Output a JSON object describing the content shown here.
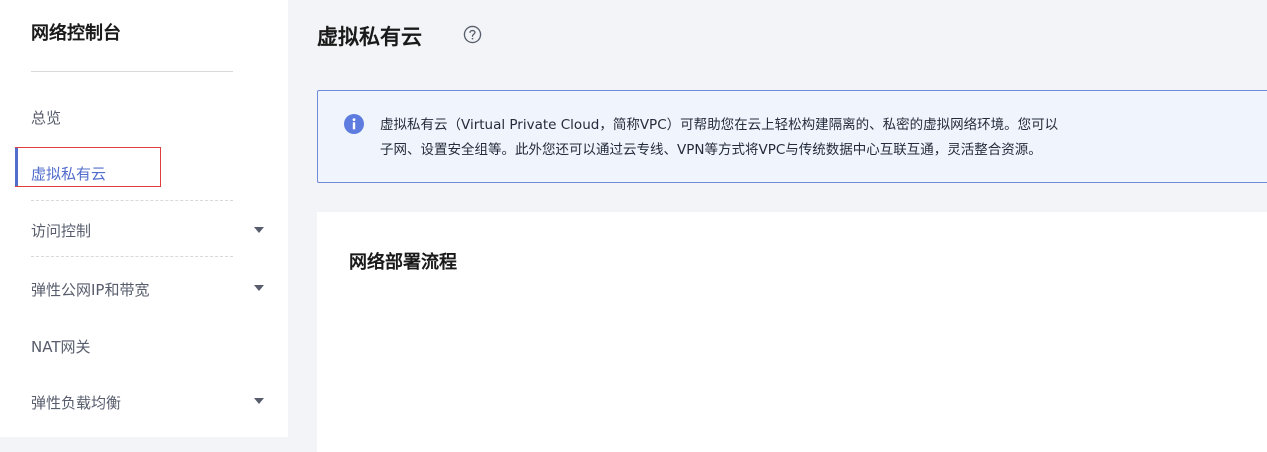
{
  "sidebar": {
    "title": "网络控制台",
    "items": [
      {
        "label": "总览",
        "has_submenu": false,
        "active": false
      },
      {
        "label": "虚拟私有云",
        "has_submenu": false,
        "active": true
      },
      {
        "label": "访问控制",
        "has_submenu": true,
        "active": false
      },
      {
        "label": "弹性公网IP和带宽",
        "has_submenu": true,
        "active": false
      },
      {
        "label": "NAT网关",
        "has_submenu": false,
        "active": false
      },
      {
        "label": "弹性负载均衡",
        "has_submenu": true,
        "active": false
      }
    ]
  },
  "main": {
    "title": "虚拟私有云",
    "info": {
      "line1": "虚拟私有云（Virtual Private Cloud，简称VPC）可帮助您在云上轻松构建隔离的、私密的虚拟网络环境。您可以",
      "line2": "子网、设置安全组等。此外您还可以通过云专线、VPN等方式将VPC与传统数据中心互联互通，灵活整合资源。"
    },
    "card": {
      "title": "网络部署流程"
    }
  },
  "colors": {
    "accent": "#526ecc",
    "highlight_frame": "#e03e3e",
    "info_border": "#6f8ad8",
    "info_icon": "#5e7ce0"
  },
  "icons": {
    "help": "question-circle-icon",
    "info": "info-circle-icon",
    "submenu": "caret-down-icon"
  }
}
